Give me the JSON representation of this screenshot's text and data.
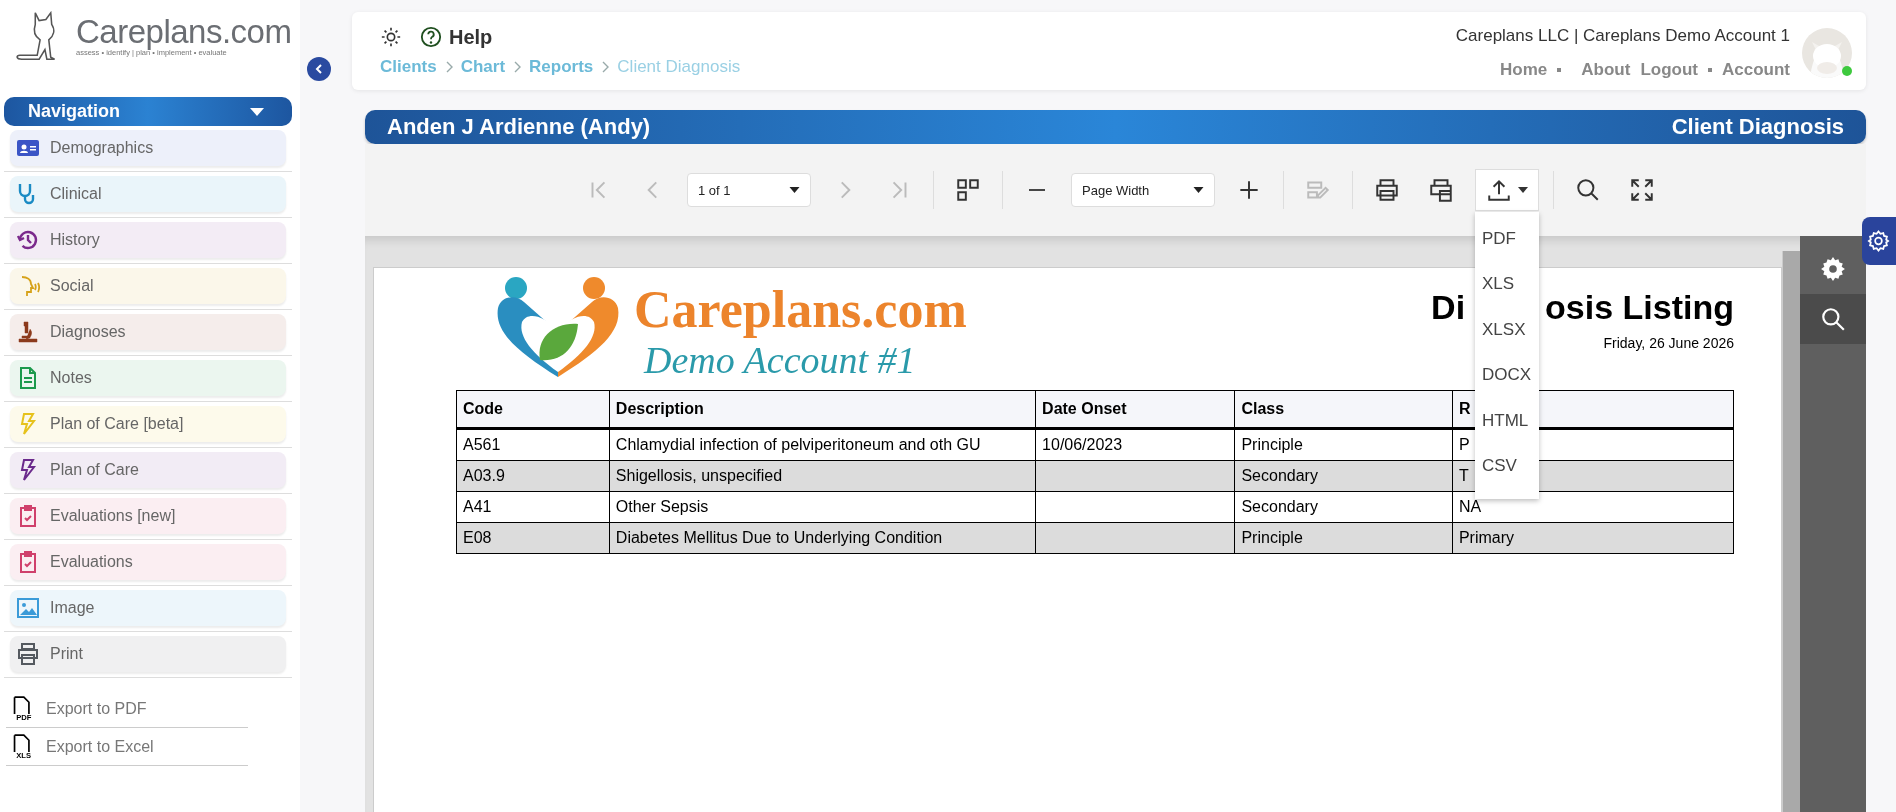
{
  "sidebar": {
    "logo": {
      "name": "Careplans.com",
      "tagline": "assess • identify | plan • implement • evaluate"
    },
    "navigation": {
      "title": "Navigation",
      "expanded": true,
      "items": [
        {
          "label": "Demographics",
          "color": "#3b55c6"
        },
        {
          "label": "Clinical",
          "color": "#1b8bc4"
        },
        {
          "label": "History",
          "color": "#7b2a8c"
        },
        {
          "label": "Social",
          "color": "#d6a21a"
        },
        {
          "label": "Diagnoses",
          "color": "#8c3b1c"
        },
        {
          "label": "Notes",
          "color": "#1c9a4c"
        },
        {
          "label": "Plan of Care [beta]",
          "color": "#e6c21c"
        },
        {
          "label": "Plan of Care",
          "color": "#6b2a8c"
        },
        {
          "label": "Evaluations [new]",
          "color": "#d0406c"
        },
        {
          "label": "Evaluations",
          "color": "#d0406c"
        },
        {
          "label": "Image",
          "color": "#3b9bd8"
        },
        {
          "label": "Print",
          "color": "#555a60"
        }
      ]
    },
    "exports": [
      {
        "label": "Export to PDF",
        "badge": "PDF"
      },
      {
        "label": "Export to Excel",
        "badge": "XLS"
      }
    ]
  },
  "header": {
    "help": "Help",
    "breadcrumbs": [
      {
        "label": "Clients",
        "selected": false
      },
      {
        "label": "Chart",
        "selected": false
      },
      {
        "label": "Reports",
        "selected": false
      },
      {
        "label": "Client Diagnosis",
        "selected": true
      }
    ],
    "account": "Careplans LLC | Careplans Demo Account 1",
    "links": [
      [
        "Home",
        "About"
      ],
      [
        "Logout",
        "Account"
      ]
    ],
    "online": true
  },
  "title_bar": {
    "client": "Anden J Ardienne (Andy)",
    "report": "Client Diagnosis"
  },
  "toolbar": [
    {
      "kind": "button",
      "disabled": true
    },
    {
      "kind": "button",
      "disabled": true
    },
    {
      "kind": "select",
      "value": "1 of 1"
    },
    {
      "kind": "button",
      "disabled": true
    },
    {
      "kind": "button",
      "disabled": true
    },
    {
      "kind": "button",
      "disabled": false
    },
    {
      "kind": "button",
      "disabled": false
    },
    {
      "kind": "select",
      "value": "Page Width"
    },
    {
      "kind": "button",
      "disabled": false
    },
    {
      "kind": "button",
      "disabled": true
    },
    {
      "kind": "button",
      "disabled": false
    },
    {
      "kind": "button",
      "disabled": false
    },
    {
      "kind": "menu",
      "expanded": true,
      "options": [
        "PDF",
        "XLS",
        "XLSX",
        "DOCX",
        "HTML",
        "CSV"
      ]
    },
    {
      "kind": "button",
      "disabled": false
    },
    {
      "kind": "button",
      "disabled": false
    }
  ],
  "report": {
    "logo": {
      "name": "Careplans.com",
      "subtitle": "Demo Account #1"
    },
    "title_parts": [
      "Di",
      "osis Listing"
    ],
    "date": "Friday, 26 June 2026",
    "table": {
      "columns": [
        "Code",
        "Description",
        "Date Onset",
        "Class",
        "R"
      ],
      "rows": [
        [
          "A561",
          "Chlamydial infection of pelviperitoneum and oth GU",
          "10/06/2023",
          "Principle",
          "P"
        ],
        [
          "A03.9",
          "Shigellosis, unspecified",
          null,
          "Secondary",
          "T"
        ],
        [
          "A41",
          "Other Sepsis",
          null,
          "Secondary",
          "NA"
        ],
        [
          "E08",
          "Diabetes Mellitus Due to Underlying Condition",
          null,
          "Principle",
          "Primary"
        ]
      ]
    }
  }
}
